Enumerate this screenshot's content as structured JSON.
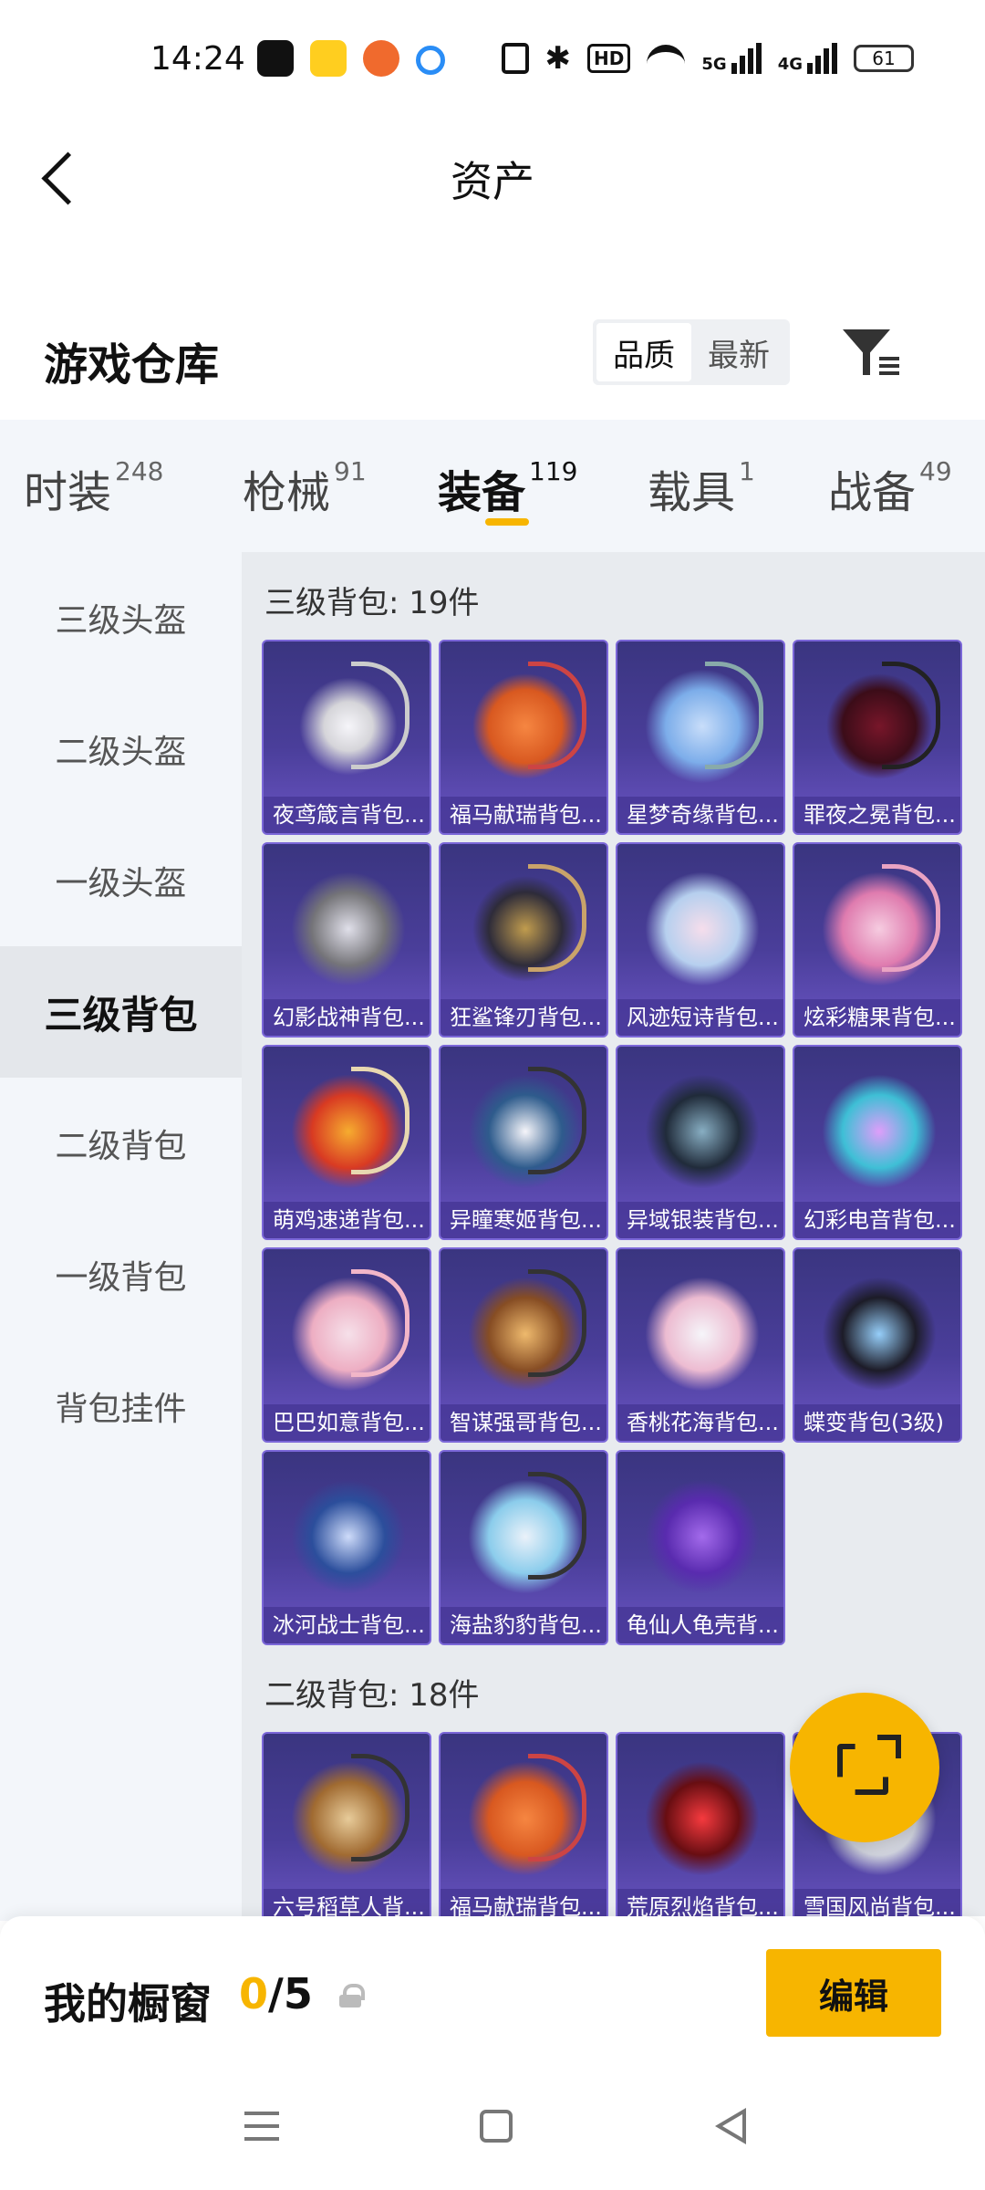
{
  "status_bar": {
    "time": "14:24",
    "battery": "61",
    "icons": [
      "tiktok-icon",
      "meituan-icon",
      "game-icon",
      "search-app-icon",
      "nfc-icon",
      "bluetooth-icon",
      "hd-icon",
      "wifi-icon",
      "signal-5g-icon",
      "signal-4g-icon",
      "battery-icon"
    ],
    "hd_label": "HD",
    "net1": "5G",
    "net2": "4G"
  },
  "header": {
    "title": "资产"
  },
  "warehouse": {
    "title": "游戏仓库",
    "sort_options": [
      "品质",
      "最新"
    ],
    "active_sort": "品质"
  },
  "tabs": [
    {
      "label": "时装",
      "count": "248"
    },
    {
      "label": "枪械",
      "count": "91"
    },
    {
      "label": "装备",
      "count": "119"
    },
    {
      "label": "载具",
      "count": "1"
    },
    {
      "label": "战备",
      "count": "49"
    }
  ],
  "active_tab": "装备",
  "sidebar": [
    {
      "label": "三级头盔"
    },
    {
      "label": "二级头盔"
    },
    {
      "label": "一级头盔"
    },
    {
      "label": "三级背包"
    },
    {
      "label": "二级背包"
    },
    {
      "label": "一级背包"
    },
    {
      "label": "背包挂件"
    }
  ],
  "active_sidebar": "三级背包",
  "groups": [
    {
      "title": "三级背包: 19件",
      "items": [
        "夜鸢箴言背包...",
        "福马献瑞背包...",
        "星梦奇缘背包...",
        "罪夜之冕背包...",
        "幻影战神背包...",
        "狂鲨锋刃背包...",
        "风迹短诗背包...",
        "炫彩糖果背包...",
        "萌鸡速递背包...",
        "异瞳寒姬背包...",
        "异域银装背包...",
        "幻彩电音背包...",
        "巴巴如意背包...",
        "智谋强哥背包...",
        "香桃花海背包...",
        "蝶变背包(3级)",
        "冰河战士背包...",
        "海盐豹豹背包...",
        "龟仙人龟壳背..."
      ]
    },
    {
      "title": "二级背包: 18件",
      "items": [
        "六号稻草人背...",
        "福马献瑞背包...",
        "荒原烈焰背包...",
        "雪国风尚背包..."
      ]
    }
  ],
  "showcase": {
    "title": "我的橱窗",
    "current": "0",
    "separator": "/",
    "total": "5",
    "edit_label": "编辑"
  },
  "colors": {
    "accent": "#f7b500",
    "card_bg": "#4a3e9a"
  }
}
